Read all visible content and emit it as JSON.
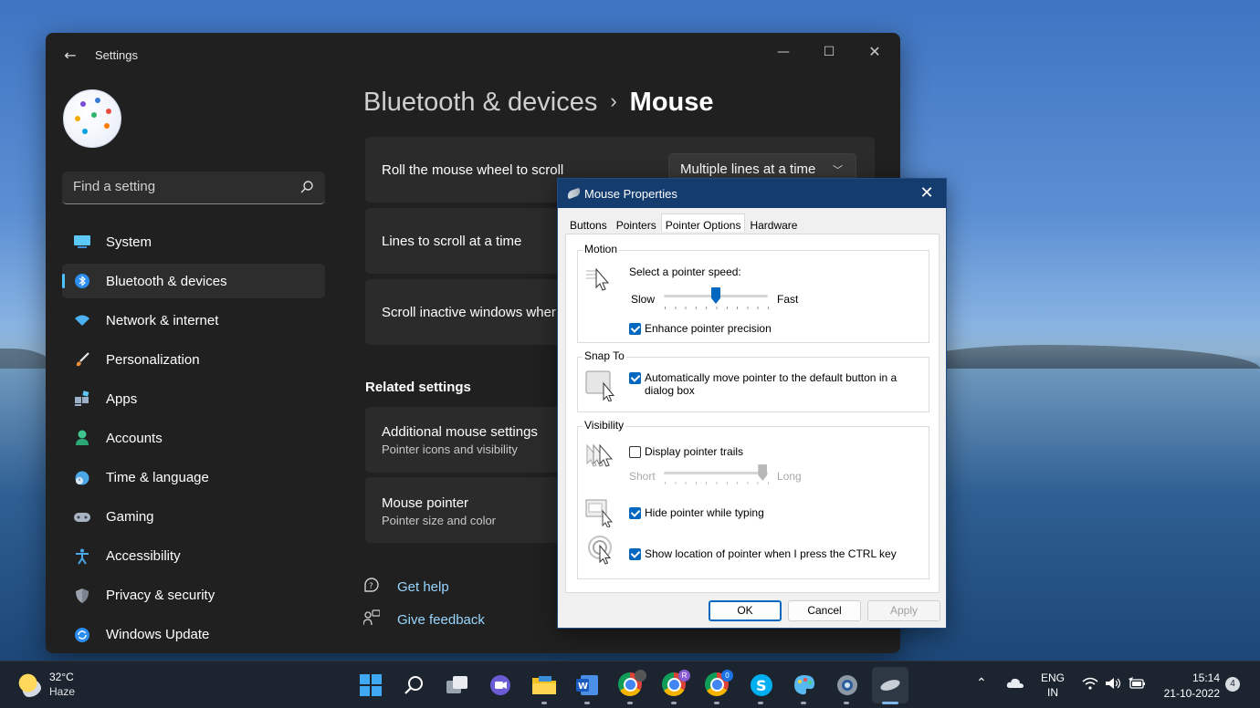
{
  "settings": {
    "window_title": "Settings",
    "search_placeholder": "Find a setting",
    "nav": [
      {
        "label": "System",
        "icon": "monitor-icon"
      },
      {
        "label": "Bluetooth & devices",
        "icon": "bluetooth-icon",
        "active": true
      },
      {
        "label": "Network & internet",
        "icon": "wifi-icon"
      },
      {
        "label": "Personalization",
        "icon": "brush-icon"
      },
      {
        "label": "Apps",
        "icon": "apps-icon"
      },
      {
        "label": "Accounts",
        "icon": "person-icon"
      },
      {
        "label": "Time & language",
        "icon": "globe-clock-icon"
      },
      {
        "label": "Gaming",
        "icon": "gamepad-icon"
      },
      {
        "label": "Accessibility",
        "icon": "accessibility-icon"
      },
      {
        "label": "Privacy & security",
        "icon": "shield-icon"
      },
      {
        "label": "Windows Update",
        "icon": "update-icon"
      }
    ],
    "breadcrumb": {
      "parent": "Bluetooth & devices",
      "separator": "›",
      "current": "Mouse"
    },
    "cards": {
      "scroll": {
        "title": "Roll the mouse wheel to scroll",
        "value": "Multiple lines at a time"
      },
      "lines": {
        "title": "Lines to scroll at a time"
      },
      "inactive": {
        "title": "Scroll inactive windows wher"
      },
      "additional": {
        "title": "Additional mouse settings",
        "subtitle": "Pointer icons and visibility"
      },
      "pointer": {
        "title": "Mouse pointer",
        "subtitle": "Pointer size and color"
      }
    },
    "related_heading": "Related settings",
    "get_help": "Get help",
    "give_feedback": "Give feedback"
  },
  "dialog": {
    "title": "Mouse Properties",
    "tabs": [
      "Buttons",
      "Pointers",
      "Pointer Options",
      "Hardware"
    ],
    "active_tab": "Pointer Options",
    "motion": {
      "label": "Motion",
      "speed_label": "Select a pointer speed:",
      "slow": "Slow",
      "fast": "Fast",
      "speed_fraction": 0.5,
      "enhance": "Enhance pointer precision",
      "enhance_checked": true
    },
    "snap": {
      "label": "Snap To",
      "text": "Automatically move pointer to the default button in a dialog box",
      "checked": true
    },
    "visibility": {
      "label": "Visibility",
      "trails": "Display pointer trails",
      "trails_checked": false,
      "short": "Short",
      "long": "Long",
      "trail_fraction": 0.95,
      "hide": "Hide pointer while typing",
      "hide_checked": true,
      "show_ctrl": "Show location of pointer when I press the CTRL key",
      "show_ctrl_checked": true
    },
    "buttons": {
      "ok": "OK",
      "cancel": "Cancel",
      "apply": "Apply"
    }
  },
  "taskbar": {
    "temp": "32°C",
    "condition": "Haze",
    "chrome_badges": [
      "R",
      "0"
    ],
    "lang": "ENG",
    "region": "IN",
    "time": "15:14",
    "date": "21-10-2022",
    "notifications": "4"
  },
  "colors": {
    "accent": "#4cc2ff",
    "link": "#99d6ff",
    "dialog_accent": "#0067c0"
  }
}
